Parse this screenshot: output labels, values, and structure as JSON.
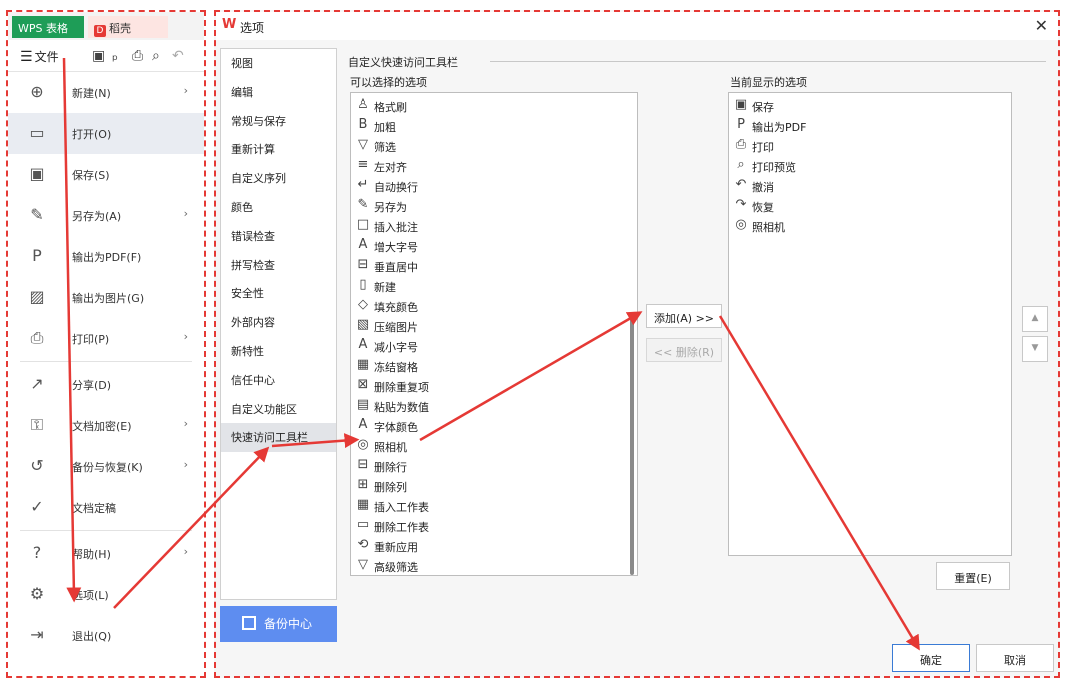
{
  "app_tabs": {
    "wps": "WPS 表格",
    "draft": "稻壳",
    "draft_logo": "D"
  },
  "toolbar": {
    "file_label": "文件",
    "hamburger": "☰"
  },
  "file_menu": {
    "items": [
      {
        "label": "新建(N)",
        "icon": "new-file-icon",
        "glyph": "⊕",
        "arrow": "›"
      },
      {
        "label": "打开(O)",
        "icon": "folder-open-icon",
        "glyph": "▭",
        "arrow": ""
      },
      {
        "label": "保存(S)",
        "icon": "save-icon",
        "glyph": "▣",
        "arrow": ""
      },
      {
        "label": "另存为(A)",
        "icon": "save-as-icon",
        "glyph": "✎",
        "arrow": "›"
      },
      {
        "label": "输出为PDF(F)",
        "icon": "export-pdf-icon",
        "glyph": "P",
        "arrow": ""
      },
      {
        "label": "输出为图片(G)",
        "icon": "export-image-icon",
        "glyph": "▨",
        "arrow": ""
      },
      {
        "label": "打印(P)",
        "icon": "print-icon",
        "glyph": "⎙",
        "arrow": "›"
      },
      {
        "label": "分享(D)",
        "icon": "share-icon",
        "glyph": "↗",
        "arrow": ""
      },
      {
        "label": "文档加密(E)",
        "icon": "encrypt-icon",
        "glyph": "⚿",
        "arrow": "›"
      },
      {
        "label": "备份与恢复(K)",
        "icon": "backup-restore-icon",
        "glyph": "↺",
        "arrow": "›"
      },
      {
        "label": "文档定稿",
        "icon": "finalize-icon",
        "glyph": "✓",
        "arrow": ""
      },
      {
        "label": "帮助(H)",
        "icon": "help-icon",
        "glyph": "?",
        "arrow": "›"
      },
      {
        "label": "选项(L)",
        "icon": "gear-icon",
        "glyph": "⚙",
        "arrow": ""
      },
      {
        "label": "退出(Q)",
        "icon": "exit-icon",
        "glyph": "⇥",
        "arrow": ""
      }
    ]
  },
  "dialog": {
    "title": "选项",
    "logo_glyph": "W",
    "close_glyph": "✕",
    "categories": [
      "视图",
      "编辑",
      "常规与保存",
      "重新计算",
      "自定义序列",
      "颜色",
      "错误检查",
      "拼写检查",
      "安全性",
      "外部内容",
      "新特性",
      "信任中心",
      "自定义功能区",
      "快速访问工具栏"
    ],
    "backup_center": "备份中心",
    "section_title": "自定义快速访问工具栏",
    "available_label": "可以选择的选项",
    "current_label": "当前显示的选项",
    "available_items": [
      {
        "label": "格式刷",
        "glyph": "♙"
      },
      {
        "label": "加粗",
        "glyph": "B"
      },
      {
        "label": "筛选",
        "glyph": "▽"
      },
      {
        "label": "左对齐",
        "glyph": "≡"
      },
      {
        "label": "自动换行",
        "glyph": "↵"
      },
      {
        "label": "另存为",
        "glyph": "✎"
      },
      {
        "label": "插入批注",
        "glyph": "□"
      },
      {
        "label": "增大字号",
        "glyph": "A"
      },
      {
        "label": "垂直居中",
        "glyph": "⊟"
      },
      {
        "label": "新建",
        "glyph": "▯"
      },
      {
        "label": "填充颜色",
        "glyph": "◇"
      },
      {
        "label": "压缩图片",
        "glyph": "▧"
      },
      {
        "label": "减小字号",
        "glyph": "A"
      },
      {
        "label": "冻结窗格",
        "glyph": "▦"
      },
      {
        "label": "删除重复项",
        "glyph": "⊠"
      },
      {
        "label": "粘贴为数值",
        "glyph": "▤"
      },
      {
        "label": "字体颜色",
        "glyph": "A"
      },
      {
        "label": "照相机",
        "glyph": "◎"
      },
      {
        "label": "删除行",
        "glyph": "⊟"
      },
      {
        "label": "删除列",
        "glyph": "⊞"
      },
      {
        "label": "插入工作表",
        "glyph": "▦"
      },
      {
        "label": "删除工作表",
        "glyph": "▭"
      },
      {
        "label": "重新应用",
        "glyph": "⟲"
      },
      {
        "label": "高级筛选",
        "glyph": "▽"
      }
    ],
    "current_items": [
      {
        "label": "保存",
        "glyph": "▣"
      },
      {
        "label": "输出为PDF",
        "glyph": "P"
      },
      {
        "label": "打印",
        "glyph": "⎙"
      },
      {
        "label": "打印预览",
        "glyph": "⌕"
      },
      {
        "label": "撤消",
        "glyph": "↶"
      },
      {
        "label": "恢复",
        "glyph": "↷"
      },
      {
        "label": "照相机",
        "glyph": "◎"
      }
    ],
    "add_button": "添加(A) >>",
    "remove_button": "<< 删除(R)",
    "move_up": "▲",
    "move_down": "▼",
    "reset_button": "重置(E)",
    "ok_button": "确定",
    "cancel_button": "取消"
  },
  "colors": {
    "annotation_red": "#e53935",
    "wps_green": "#1e9d57",
    "accent_blue": "#5e8df0"
  }
}
